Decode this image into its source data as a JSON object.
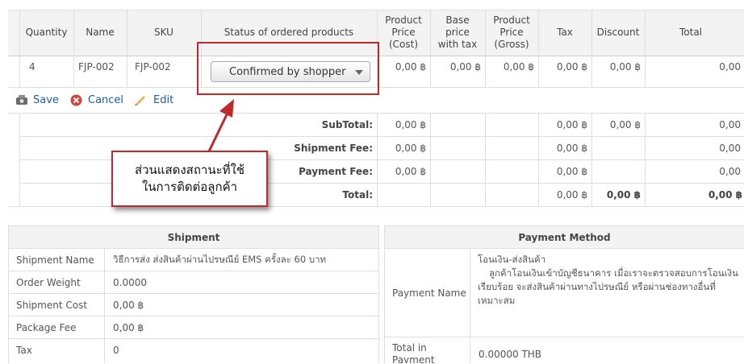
{
  "orders_table": {
    "columns": [
      "Quantity",
      "Name",
      "SKU",
      "Status of ordered products",
      "Product Price (Cost)",
      "Base price with tax",
      "Product Price (Gross)",
      "Tax",
      "Discount",
      "Total"
    ],
    "row": {
      "quantity": "4",
      "name": "FJP-002",
      "sku": "FJP-002",
      "status": "Confirmed by shopper",
      "cost": "0,00 ฿",
      "base": "0,00 ฿",
      "gross": "0,00 ฿",
      "tax": "0,00 ฿",
      "discount": "0,00 ฿",
      "total": "0,00"
    }
  },
  "actions": {
    "save": "Save",
    "cancel": "Cancel",
    "edit": "Edit"
  },
  "summary": {
    "subtotal": {
      "label": "SubTotal:",
      "cost": "0,00 ฿",
      "tax": "0,00 ฿",
      "discount": "0,00 ฿",
      "total": "0,00"
    },
    "shipment_fee": {
      "label": "Shipment Fee:",
      "cost": "0,00 ฿",
      "tax": "0,00 ฿",
      "total": "0,00"
    },
    "payment_fee": {
      "label": "Payment Fee:",
      "cost": "0,00 ฿",
      "tax": "0,00 ฿",
      "total": "0,00"
    },
    "total": {
      "label": "Total:",
      "tax": "0,00 ฿",
      "discount": "0,00 ฿",
      "total": "0,00 ฿"
    }
  },
  "callout": {
    "line1": "ส่วนแสดงสถานะที่ใช้",
    "line2": "ในการติดต่อลูกค้า"
  },
  "shipment": {
    "title": "Shipment",
    "rows": [
      {
        "label": "Shipment Name",
        "value": "วิธีการส่ง ส่งสินค้าผ่านไปรษณีย์ EMS ครั้งละ 60 บาท"
      },
      {
        "label": "Order Weight",
        "value": "0.0000"
      },
      {
        "label": "Shipment Cost",
        "value": "0,00 ฿"
      },
      {
        "label": "Package Fee",
        "value": "0,00 ฿"
      },
      {
        "label": "Tax",
        "value": "0"
      }
    ]
  },
  "payment": {
    "title": "Payment Method",
    "name_label": "Payment Name",
    "name_title": "โอนเงิน-ส่งสินค้า",
    "name_desc1": "ลูกค้าโอนเงินเข้าบัญชีธนาคาร เมื่อเราจะตรวจสอบการโอนเงิน",
    "name_desc2": "เรียบร้อย จะส่งสินค้าผ่านทางไปรษณีย์ หรือผ่านช่องทางอื่นที่",
    "name_desc3": "เหมาะสม",
    "currency_label": "Total in Payment Currency",
    "currency_value": "0.00000 THB"
  },
  "colors": {
    "highlight": "#c0282c",
    "link": "#1d5fa3"
  }
}
